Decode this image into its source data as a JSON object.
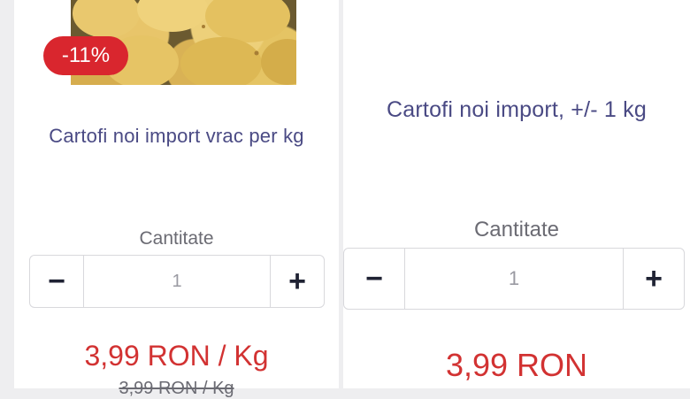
{
  "products": [
    {
      "discount_badge": "-11%",
      "title": "Cartofi noi import vrac per kg",
      "quantity_label": "Cantitate",
      "quantity": "1",
      "minus_symbol": "−",
      "plus_symbol": "+",
      "price": "3,99 RON / Kg",
      "old_price": "3,99 RON / Kg"
    },
    {
      "title": "Cartofi noi import, +/- 1 kg",
      "quantity_label": "Cantitate",
      "quantity": "1",
      "minus_symbol": "−",
      "plus_symbol": "+",
      "price": "3,99 RON"
    }
  ],
  "colors": {
    "accent_red": "#d9262e",
    "title_text": "#4a4a84",
    "price_red": "#d23232"
  }
}
